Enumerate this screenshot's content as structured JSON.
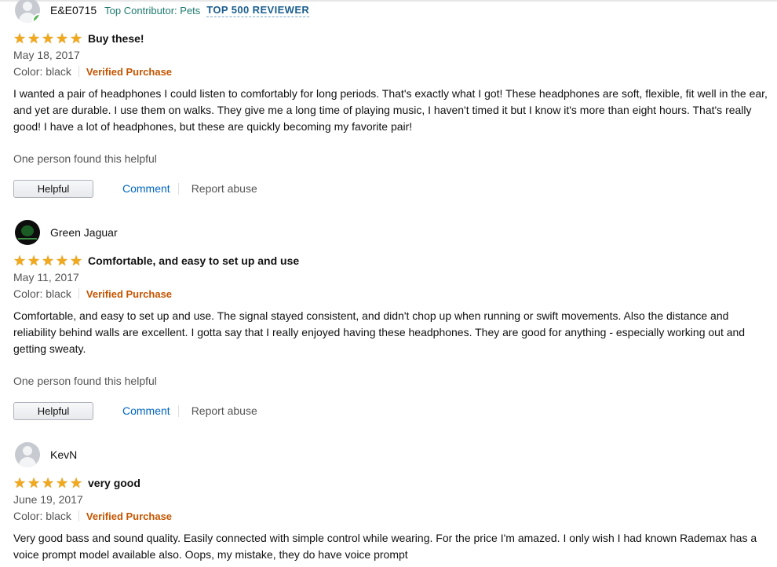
{
  "reviews": [
    {
      "avatar": "default-avatar-icon",
      "name": "E&E0715",
      "contributor": "Top Contributor: Pets",
      "rank": "TOP 500 REVIEWER",
      "stars": 5,
      "title": "Buy these!",
      "date": "May 18, 2017",
      "color": "Color: black",
      "verified": "Verified Purchase",
      "body": "I wanted a pair of headphones I could listen to comfortably for long periods. That's exactly what I got! These headphones are soft, flexible, fit well in the ear, and yet are durable. I use them on walks. They give me a long time of playing music, I haven't timed it but I know it's more than eight hours. That's really good! I have a lot of headphones, but these are quickly becoming my favorite pair!",
      "helpful_count": "One person found this helpful",
      "helpful_button": "Helpful",
      "comment": "Comment",
      "report": "Report abuse"
    },
    {
      "avatar": "custom-avatar-image",
      "name": "Green Jaguar",
      "stars": 5,
      "title": "Comfortable, and easy to set up and use",
      "date": "May 11, 2017",
      "color": "Color: black",
      "verified": "Verified Purchase",
      "body": "Comfortable, and easy to set up and use. The signal stayed consistent, and didn't chop up when running or swift movements. Also the distance and reliability behind walls are excellent. I gotta say that I really enjoyed having these headphones. They are good for anything - especially working out and getting sweaty.",
      "helpful_count": "One person found this helpful",
      "helpful_button": "Helpful",
      "comment": "Comment",
      "report": "Report abuse"
    },
    {
      "avatar": "default-avatar-icon",
      "name": "KevN",
      "stars": 5,
      "title": "very good",
      "date": "June 19, 2017",
      "color": "Color: black",
      "verified": "Verified Purchase",
      "body": "Very good bass and sound quality. Easily connected with simple control while wearing. For the price I'm amazed. I only wish I had known Rademax has a voice prompt model available also. Oops, my mistake, they do have voice prompt"
    }
  ],
  "colors": {
    "star": "#f0a81d",
    "verified": "#c45500",
    "link": "#0066c0",
    "contributor": "#1d7a6e",
    "rank": "#1a5e8f"
  }
}
